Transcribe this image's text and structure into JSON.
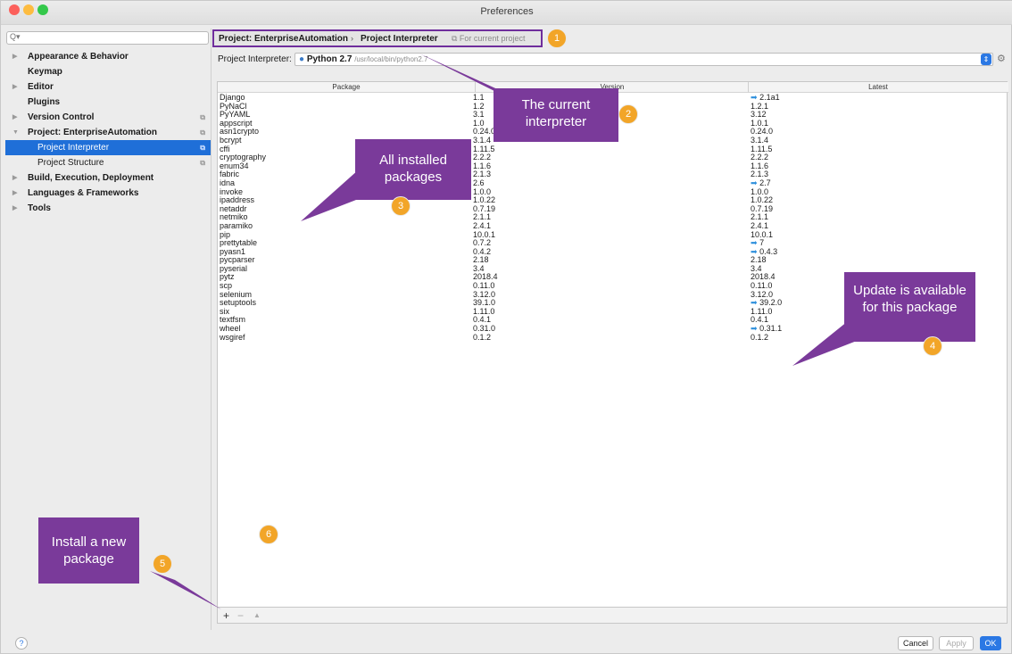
{
  "window": {
    "title": "Preferences"
  },
  "search": {
    "placeholder": "Q▾"
  },
  "sidebar": {
    "items": [
      {
        "label": "Appearance & Behavior",
        "arrow": "▶",
        "copy": ""
      },
      {
        "label": "Keymap",
        "arrow": "",
        "copy": ""
      },
      {
        "label": "Editor",
        "arrow": "▶",
        "copy": ""
      },
      {
        "label": "Plugins",
        "arrow": "",
        "copy": ""
      },
      {
        "label": "Version Control",
        "arrow": "▶",
        "copy": "⧉"
      },
      {
        "label": "Project: EnterpriseAutomation",
        "arrow": "▼",
        "copy": "⧉"
      },
      {
        "label": "Project Interpreter",
        "arrow": "",
        "copy": "⧉"
      },
      {
        "label": "Project Structure",
        "arrow": "",
        "copy": "⧉"
      },
      {
        "label": "Build, Execution, Deployment",
        "arrow": "▶",
        "copy": ""
      },
      {
        "label": "Languages & Frameworks",
        "arrow": "▶",
        "copy": ""
      },
      {
        "label": "Tools",
        "arrow": "▶",
        "copy": ""
      }
    ]
  },
  "breadcrumb": {
    "project": "Project: EnterpriseAutomation",
    "separator": "›",
    "page": "Project Interpreter",
    "scope": "⧉ For current project"
  },
  "interpreter": {
    "label": "Project Interpreter:",
    "name": "Python 2.7",
    "path": "/usr/local/bin/python2.7"
  },
  "table": {
    "headers": [
      "Package",
      "Version",
      "Latest"
    ],
    "rows": [
      [
        "Django",
        "1.1",
        "2.1a1",
        true
      ],
      [
        "PyNaCl",
        "1.2",
        "1.2.1",
        false
      ],
      [
        "PyYAML",
        "3.1",
        "3.12",
        false
      ],
      [
        "appscript",
        "1.0",
        "1.0.1",
        false
      ],
      [
        "asn1crypto",
        "0.24.0",
        "0.24.0",
        false
      ],
      [
        "bcrypt",
        "3.1.4",
        "3.1.4",
        false
      ],
      [
        "cffi",
        "1.11.5",
        "1.11.5",
        false
      ],
      [
        "cryptography",
        "2.2.2",
        "2.2.2",
        false
      ],
      [
        "enum34",
        "1.1.6",
        "1.1.6",
        false
      ],
      [
        "fabric",
        "2.1.3",
        "2.1.3",
        false
      ],
      [
        "idna",
        "2.6",
        "2.7",
        true
      ],
      [
        "invoke",
        "1.0.0",
        "1.0.0",
        false
      ],
      [
        "ipaddress",
        "1.0.22",
        "1.0.22",
        false
      ],
      [
        "netaddr",
        "0.7.19",
        "0.7.19",
        false
      ],
      [
        "netmiko",
        "2.1.1",
        "2.1.1",
        false
      ],
      [
        "paramiko",
        "2.4.1",
        "2.4.1",
        false
      ],
      [
        "pip",
        "10.0.1",
        "10.0.1",
        false
      ],
      [
        "prettytable",
        "0.7.2",
        "7",
        true
      ],
      [
        "pyasn1",
        "0.4.2",
        "0.4.3",
        true
      ],
      [
        "pycparser",
        "2.18",
        "2.18",
        false
      ],
      [
        "pyserial",
        "3.4",
        "3.4",
        false
      ],
      [
        "pytz",
        "2018.4",
        "2018.4",
        false
      ],
      [
        "scp",
        "0.11.0",
        "0.11.0",
        false
      ],
      [
        "selenium",
        "3.12.0",
        "3.12.0",
        false
      ],
      [
        "setuptools",
        "39.1.0",
        "39.2.0",
        true
      ],
      [
        "six",
        "1.11.0",
        "1.11.0",
        false
      ],
      [
        "textfsm",
        "0.4.1",
        "0.4.1",
        false
      ],
      [
        "wheel",
        "0.31.0",
        "0.31.1",
        true
      ],
      [
        "wsgiref",
        "0.1.2",
        "0.1.2",
        false
      ]
    ],
    "update_arrow": "➡"
  },
  "toolbar": {
    "add": "+",
    "remove": "−",
    "up": "▲"
  },
  "footer": {
    "help": "?",
    "cancel": "Cancel",
    "apply": "Apply",
    "ok": "OK"
  },
  "callouts": {
    "c2": "The current interpreter",
    "c3": "All installed packages",
    "c4": "Update is available for this package",
    "c5": "Install a new package"
  },
  "badges": {
    "b1": "1",
    "b2": "2",
    "b3": "3",
    "b4": "4",
    "b5": "5",
    "b6": "6"
  },
  "colors": {
    "accent": "#1f6fd8",
    "callout": "#7a3a9a",
    "badge": "#f2a528",
    "update_arrow": "#2d8fdc"
  }
}
